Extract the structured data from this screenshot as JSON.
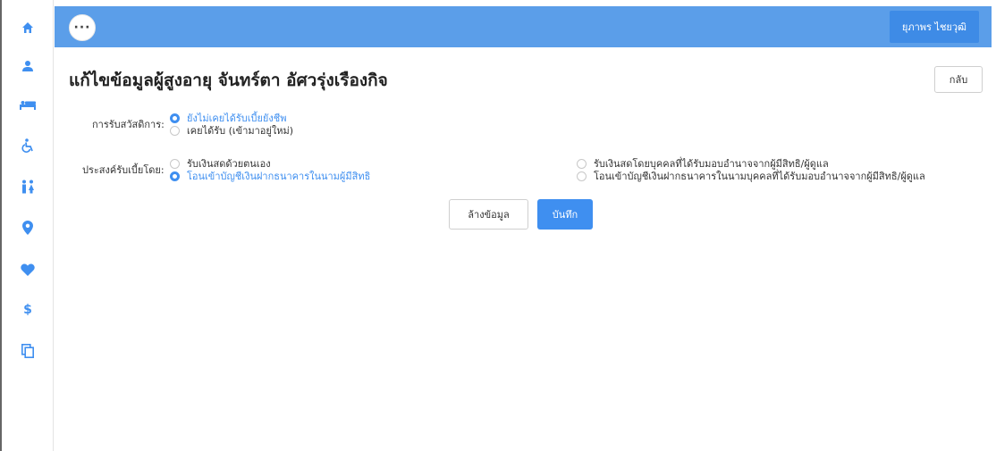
{
  "topbar": {
    "menu_label": "···",
    "user_name": "ยุภาพร ไชยวุฒิ"
  },
  "page": {
    "title": "แก้ไขข้อมูลผู้สูงอายุ จันทร์ตา อัศวรุ่งเรืองกิจ",
    "back_label": "กลับ"
  },
  "welfare": {
    "label": "การรับสวัสดิการ:",
    "options": [
      {
        "label": "ยังไม่เคยได้รับเบี้ยยังชีพ",
        "checked": true
      },
      {
        "label": "เคยได้รับ (เข้ามาอยู่ใหม่)",
        "checked": false
      }
    ]
  },
  "payment": {
    "label": "ประสงค์รับเบี้ยโดย:",
    "options": [
      {
        "label": "รับเงินสดด้วยตนเอง",
        "checked": false
      },
      {
        "label": "โอนเข้าบัญชีเงินฝากธนาคารในนามผู้มีสิทธิ",
        "checked": true
      },
      {
        "label": "รับเงินสดโดยบุคคลที่ได้รับมอบอำนาจจากผู้มีสิทธิ/ผู้ดูแล",
        "checked": false
      },
      {
        "label": "โอนเข้าบัญชีเงินฝากธนาคารในนามบุคคลที่ได้รับมอบอำนาจจากผู้มีสิทธิ/ผู้ดูแล",
        "checked": false
      }
    ]
  },
  "actions": {
    "clear_label": "ล้างข้อมูล",
    "save_label": "บันทึก"
  },
  "sidebar": {
    "icons": [
      "home-icon",
      "person-icon",
      "bed-icon",
      "wheelchair-icon",
      "family-icon",
      "location-pin-icon",
      "heart-icon",
      "dollar-icon",
      "copy-icon"
    ]
  },
  "colors": {
    "topbar": "#5b9ee9",
    "accent": "#3f8ff0",
    "user_button": "#3e8be6"
  }
}
